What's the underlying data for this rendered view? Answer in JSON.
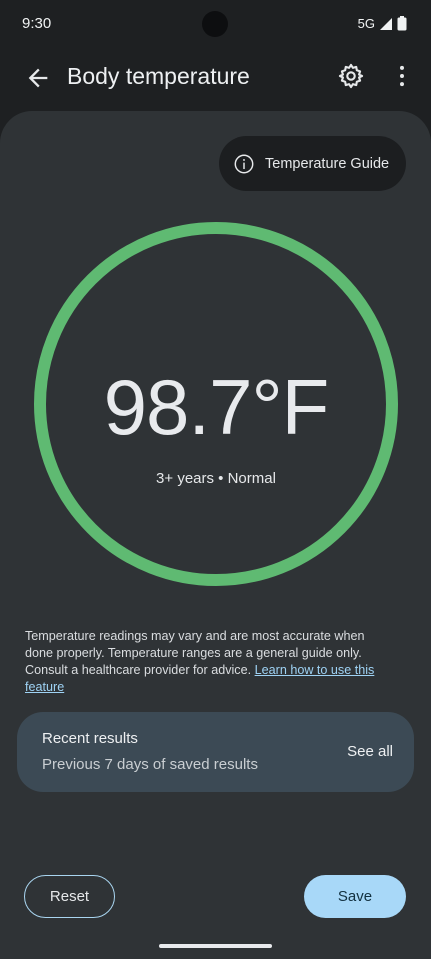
{
  "status_bar": {
    "time": "9:30",
    "network": "5G"
  },
  "app_bar": {
    "title": "Body temperature",
    "back_icon": "arrow-back-icon",
    "settings_icon": "gear-icon",
    "more_icon": "more-vert-icon"
  },
  "guide_button": {
    "label": "Temperature Guide",
    "icon": "info-icon"
  },
  "reading": {
    "value": "98.7°F",
    "subtitle": "3+ years • Normal",
    "ring_color": "#5fba72"
  },
  "disclaimer": {
    "text": "Temperature readings may vary and are most accurate when done properly. Temperature ranges are a general guide only. Consult a healthcare provider for advice. ",
    "link_text": "Learn how to use this feature"
  },
  "recent_results": {
    "title": "Recent results",
    "subtitle": "Previous 7 days of saved results",
    "action": "See all"
  },
  "actions": {
    "reset_label": "Reset",
    "save_label": "Save"
  },
  "colors": {
    "background": "#1e2022",
    "sheet": "#2f3336",
    "accent": "#a8d8f8",
    "normal_ring": "#5fba72"
  }
}
